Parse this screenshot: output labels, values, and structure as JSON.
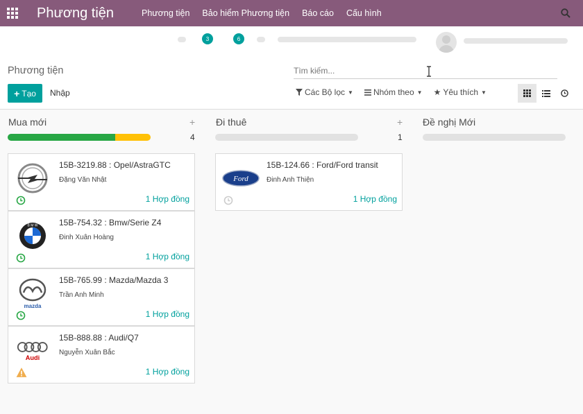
{
  "navbar": {
    "brand": "Phương tiện",
    "menu": [
      "Phương tiện",
      "Bảo hiểm Phương tiện",
      "Báo cáo",
      "Cấu hình"
    ]
  },
  "systray": {
    "badges": [
      "3",
      "6"
    ]
  },
  "control_panel": {
    "breadcrumb": "Phương tiện",
    "create_label": "Tạo",
    "import_label": "Nhập",
    "search_placeholder": "Tìm kiếm...",
    "filters": [
      "Các Bộ lọc",
      "Nhóm theo",
      "Yêu thích"
    ]
  },
  "columns": [
    {
      "title": "Mua mới",
      "count": "4",
      "progress": {
        "green": 0.75,
        "yellow": 0.25
      },
      "cards": [
        {
          "title": "15B-3219.88 : Opel/AstraGTC",
          "driver": "Đặng Văn Nhật",
          "contracts": "1 Hợp đồng",
          "logo": "opel-logo",
          "status": "clock-icon-green"
        },
        {
          "title": "15B-754.32 : Bmw/Serie Z4",
          "driver": "Đinh Xuân Hoàng",
          "contracts": "1 Hợp đồng",
          "logo": "bmw-logo",
          "status": "clock-icon-green"
        },
        {
          "title": "15B-765.99 : Mazda/Mazda 3",
          "driver": "Trần Anh Minh",
          "contracts": "1 Hợp đồng",
          "logo": "mazda-logo",
          "status": "clock-icon-green"
        },
        {
          "title": "15B-888.88 : Audi/Q7",
          "driver": "Nguyễn Xuân Bắc",
          "contracts": "1 Hợp đồng",
          "logo": "audi-logo",
          "status": "warning-icon"
        }
      ]
    },
    {
      "title": "Đi thuê",
      "count": "1",
      "progress": {
        "green": 0,
        "yellow": 0
      },
      "cards": [
        {
          "title": "15B-124.66 : Ford/Ford transit",
          "driver": "Đinh Anh Thiện",
          "contracts": "1 Hợp đồng",
          "logo": "ford-logo",
          "status": "clock-icon-grey"
        }
      ]
    },
    {
      "title": "Đề nghị Mới",
      "count": "",
      "progress": {
        "green": 0,
        "yellow": 0
      },
      "cards": []
    }
  ],
  "colors": {
    "navbar": "#875a7b",
    "primary": "#00a09d",
    "progress_green": "#28a745",
    "progress_yellow": "#ffc107"
  }
}
